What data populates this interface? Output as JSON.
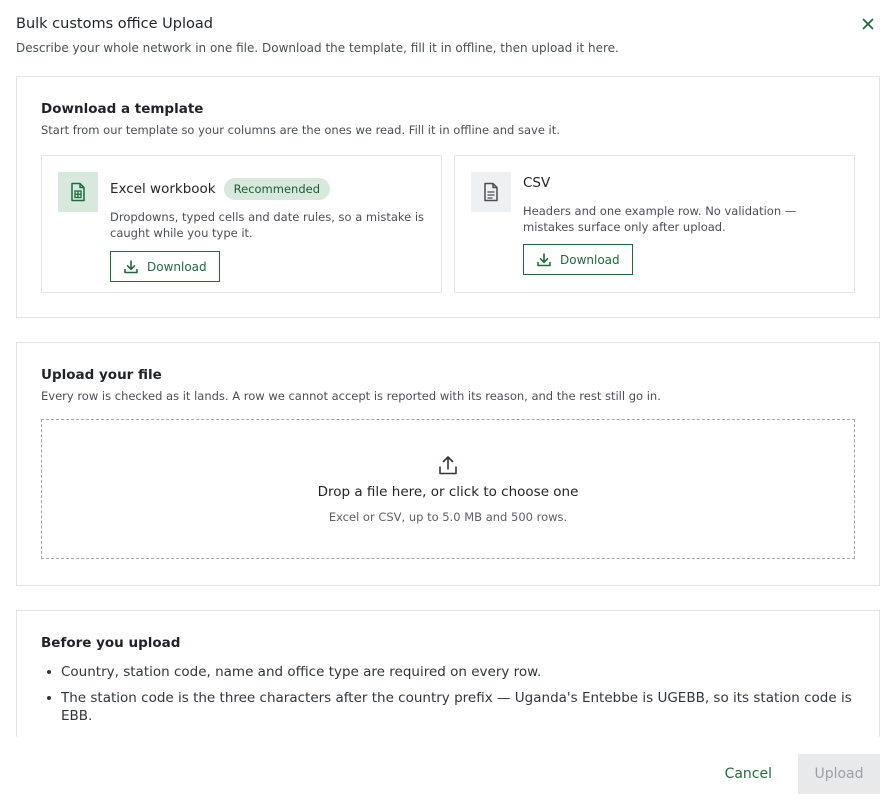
{
  "dialog": {
    "title": "Bulk customs office Upload",
    "subtitle": "Describe your whole network in one file. Download the template, fill it in offline, then upload it here."
  },
  "templates_section": {
    "heading": "Download a template",
    "description": "Start from our template so your columns are the ones we read. Fill it in offline and save it.",
    "cards": [
      {
        "name": "Excel workbook",
        "badge": "Recommended",
        "description": "Dropdowns, typed cells and date rules, so a mistake is caught while you type it.",
        "button_label": "Download",
        "icon": "spreadsheet-file-icon"
      },
      {
        "name": "CSV",
        "description": "Headers and one example row. No validation — mistakes surface only after upload.",
        "button_label": "Download",
        "icon": "text-file-icon"
      }
    ]
  },
  "upload_section": {
    "heading": "Upload your file",
    "description": "Every row is checked as it lands. A row we cannot accept is reported with its reason, and the rest still go in.",
    "dropzone_title": "Drop a file here, or click to choose one",
    "dropzone_hint": "Excel or CSV, up to 5.0 MB and 500 rows."
  },
  "tips_section": {
    "heading": "Before you upload",
    "items": [
      "Country, station code, name and office type are required on every row.",
      "The station code is the three characters after the country prefix — Uganda's Entebbe is UGEBB, so its station code is EBB."
    ]
  },
  "footer": {
    "cancel_label": "Cancel",
    "upload_label": "Upload",
    "upload_disabled": true
  },
  "colors": {
    "accent": "#1e6b3a",
    "accent_light": "#d7e9dc",
    "disabled_bg": "#e7e9eb"
  }
}
